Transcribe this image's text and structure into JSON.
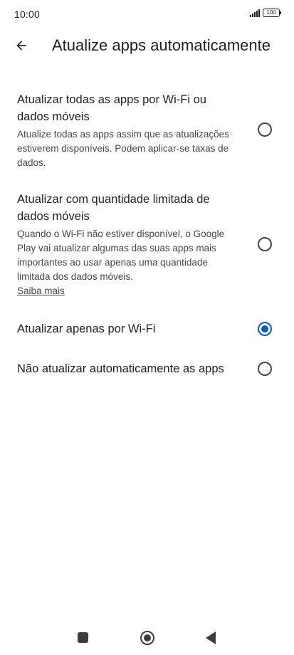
{
  "status_bar": {
    "time": "10:00",
    "battery": "100"
  },
  "header": {
    "title": "Atualize apps automaticamente",
    "back_icon": "arrow-back-icon"
  },
  "options": [
    {
      "title": "Atualizar todas as apps por Wi-Fi ou dados móveis",
      "description": "Atualize todas as apps assim que as atualizações estiverem disponíveis. Podem aplicar-se taxas de dados.",
      "selected": false
    },
    {
      "title": "Atualizar com quantidade limitada de dados móveis",
      "description": "Quando o Wi-Fi não estiver disponível, o Google Play vai atualizar algumas das suas apps mais importantes ao usar apenas uma quantidade limitada dos dados móveis.",
      "link": "Saiba mais",
      "selected": false
    },
    {
      "title": "Atualizar apenas por Wi-Fi",
      "selected": true
    },
    {
      "title": "Não atualizar automaticamente as apps",
      "selected": false
    }
  ],
  "colors": {
    "accent": "#0b57d0",
    "text_primary": "#1f1f1f",
    "text_secondary": "#444746"
  },
  "nav_bar": {
    "recents_icon": "square-icon",
    "home_icon": "circle-icon",
    "back_icon": "triangle-back-icon"
  }
}
